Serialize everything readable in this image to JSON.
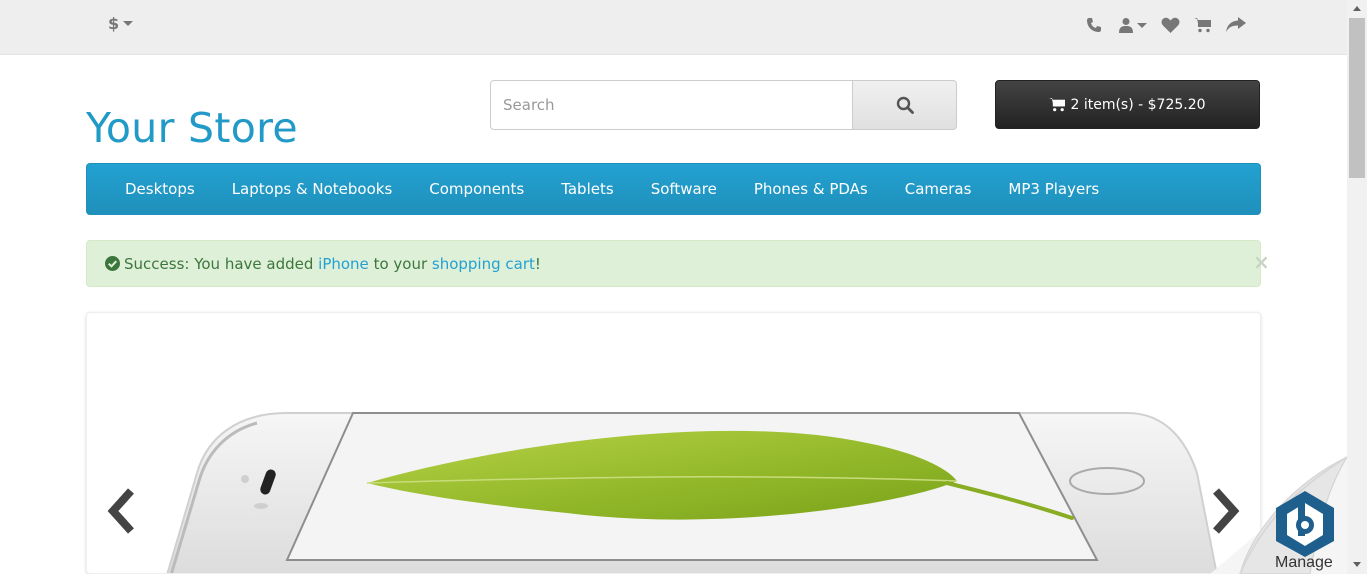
{
  "topbar": {
    "currency_symbol": "$",
    "icons": [
      "phone-icon",
      "user-icon",
      "heart-icon",
      "cart-icon",
      "share-icon"
    ]
  },
  "header": {
    "logo": "Your Store",
    "search_placeholder": "Search",
    "cart_label": "2 item(s) - $725.20"
  },
  "menu": {
    "items": [
      "Desktops",
      "Laptops & Notebooks",
      "Components",
      "Tablets",
      "Software",
      "Phones & PDAs",
      "Cameras",
      "MP3 Players"
    ]
  },
  "alert": {
    "prefix": "Success: You have added ",
    "product": "iPhone",
    "middle": " to your ",
    "cart_link": "shopping cart",
    "suffix": "!",
    "close": "×"
  },
  "widget": {
    "label": "Manage"
  },
  "colors": {
    "accent": "#229ac8",
    "menu": "#229ac8",
    "cart_button": "#303030",
    "alert_bg": "#dff0d8",
    "alert_text": "#3c763d"
  }
}
